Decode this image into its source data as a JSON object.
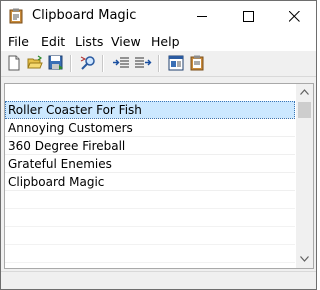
{
  "window": {
    "title": "Clipboard Magic"
  },
  "menu": {
    "file": "File",
    "edit": "Edit",
    "lists": "Lists",
    "view": "View",
    "help": "Help"
  },
  "toolbar": {
    "icons": [
      "new-document-icon",
      "open-folder-icon",
      "save-icon",
      "find-icon",
      "indent-left-icon",
      "indent-right-icon",
      "properties-icon",
      "paste-clipboard-icon"
    ]
  },
  "list": {
    "items": [
      "Roller Coaster For Fish",
      "Annoying Customers",
      "360 Degree Fireball",
      "Grateful Enemies",
      "Clipboard Magic"
    ],
    "selected_index": 0,
    "selection_color": "#cce8ff"
  }
}
